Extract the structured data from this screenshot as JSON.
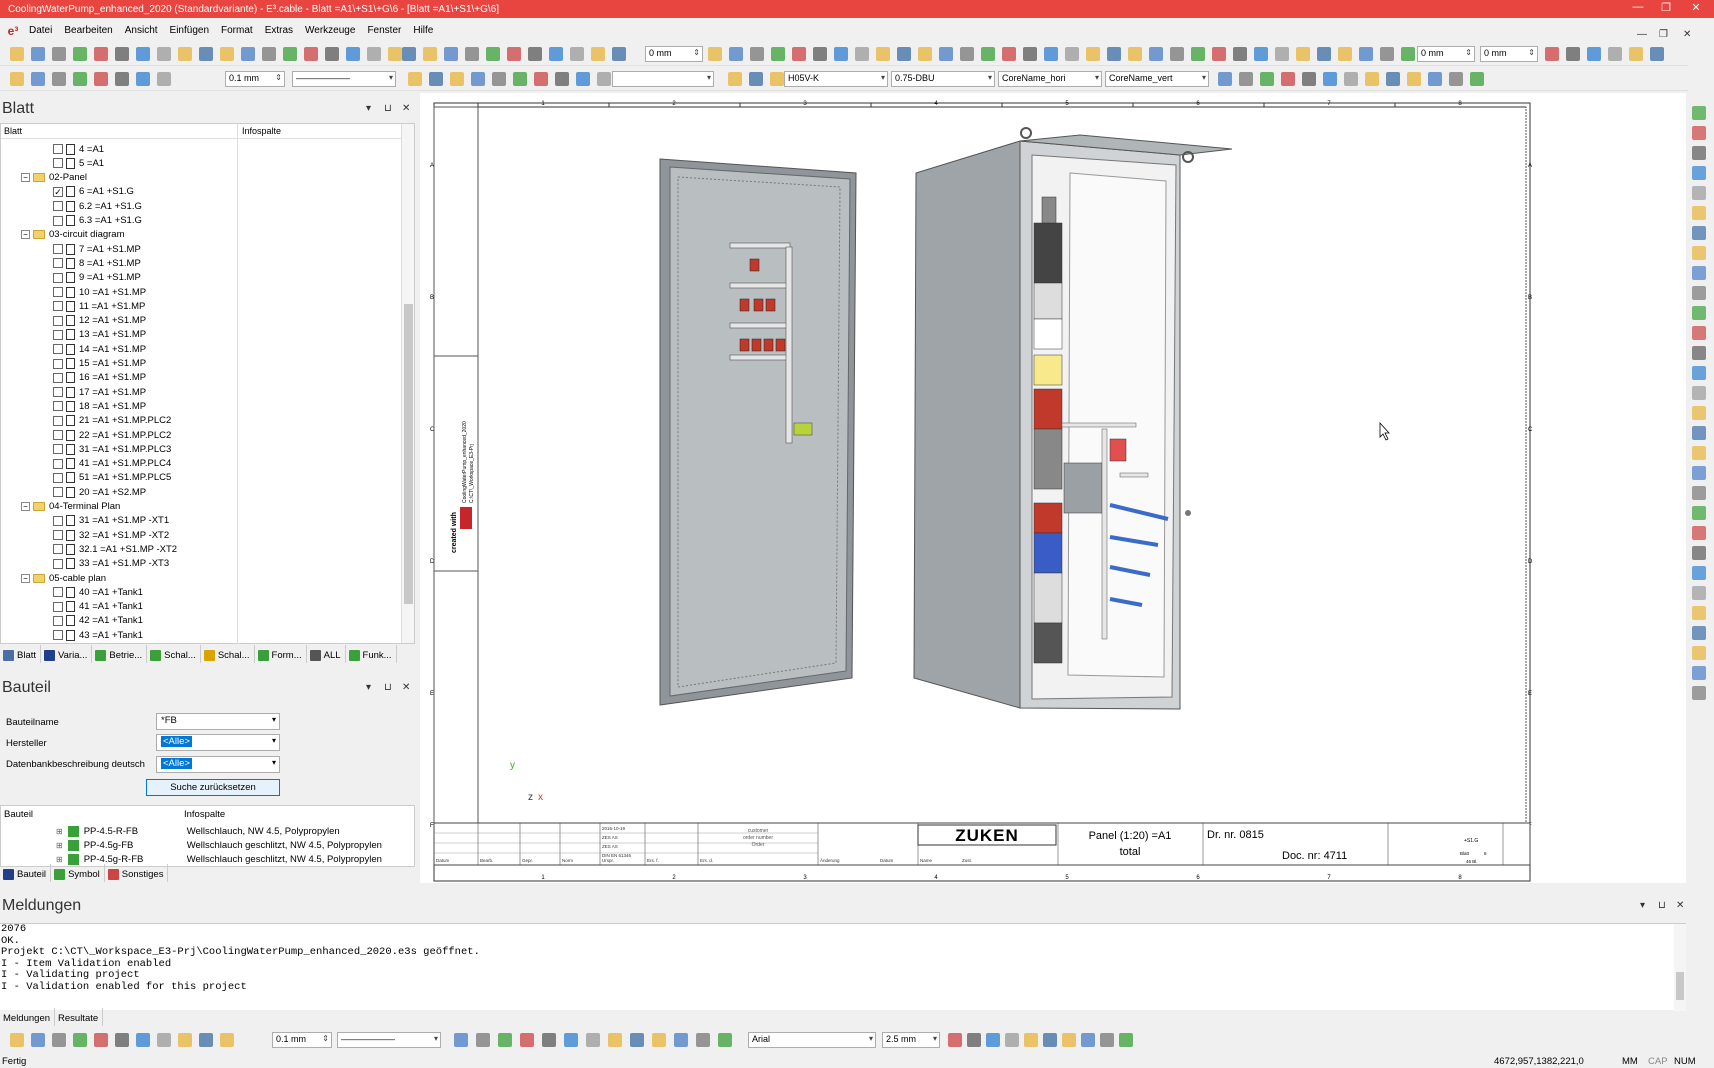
{
  "titlebar": {
    "text": "CoolingWaterPump_enhanced_2020 (Standardvariante) - E³.cable - Blatt =A1\\+S1\\+G\\6 - [Blatt =A1\\+S1\\+G\\6]",
    "min": "—",
    "restore": "❐",
    "close": "✕"
  },
  "app_logo": "e³",
  "menu": [
    "Datei",
    "Bearbeiten",
    "Ansicht",
    "Einfügen",
    "Format",
    "Extras",
    "Werkzeuge",
    "Fenster",
    "Hilfe"
  ],
  "mdi_controls": {
    "min": "—",
    "restore": "❐",
    "close": "✕"
  },
  "toolbar1": {
    "offset1": "0 mm",
    "offset2": "0 mm",
    "offset3": "0 mm"
  },
  "toolbar2": {
    "line_width": "0.1 mm",
    "cable_type": "H05V-K",
    "wire_type": "0.75-DBU",
    "core_name_h": "CoreName_hori",
    "core_name_v": "CoreName_vert"
  },
  "blatt_panel": {
    "title": "Blatt",
    "col1": "Blatt",
    "col2": "Infospalte",
    "pin": "⊔",
    "close": "✕",
    "menu": "▾"
  },
  "tree": [
    {
      "type": "page",
      "label": "4 =A1",
      "level": 2
    },
    {
      "type": "page",
      "label": "5 =A1",
      "level": 2
    },
    {
      "type": "folder",
      "label": "02-Panel",
      "level": 1
    },
    {
      "type": "page",
      "label": "6 =A1 +S1.G",
      "level": 2,
      "checked": true
    },
    {
      "type": "page",
      "label": "6.2 =A1 +S1.G",
      "level": 2
    },
    {
      "type": "page",
      "label": "6.3 =A1 +S1.G",
      "level": 2
    },
    {
      "type": "folder",
      "label": "03-circuit diagram",
      "level": 1
    },
    {
      "type": "page",
      "label": "7 =A1 +S1.MP",
      "level": 2
    },
    {
      "type": "page",
      "label": "8 =A1 +S1.MP",
      "level": 2
    },
    {
      "type": "page",
      "label": "9 =A1 +S1.MP",
      "level": 2
    },
    {
      "type": "page",
      "label": "10 =A1 +S1.MP",
      "level": 2
    },
    {
      "type": "page",
      "label": "11 =A1 +S1.MP",
      "level": 2
    },
    {
      "type": "page",
      "label": "12 =A1 +S1.MP",
      "level": 2
    },
    {
      "type": "page",
      "label": "13 =A1 +S1.MP",
      "level": 2
    },
    {
      "type": "page",
      "label": "14 =A1 +S1.MP",
      "level": 2
    },
    {
      "type": "page",
      "label": "15 =A1 +S1.MP",
      "level": 2
    },
    {
      "type": "page",
      "label": "16 =A1 +S1.MP",
      "level": 2
    },
    {
      "type": "page",
      "label": "17 =A1 +S1.MP",
      "level": 2
    },
    {
      "type": "page",
      "label": "18 =A1 +S1.MP",
      "level": 2
    },
    {
      "type": "page",
      "label": "21 =A1 +S1.MP.PLC2",
      "level": 2
    },
    {
      "type": "page",
      "label": "22 =A1 +S1.MP.PLC2",
      "level": 2
    },
    {
      "type": "page",
      "label": "31 =A1 +S1.MP.PLC3",
      "level": 2
    },
    {
      "type": "page",
      "label": "41 =A1 +S1.MP.PLC4",
      "level": 2
    },
    {
      "type": "page",
      "label": "51 =A1 +S1.MP.PLC5",
      "level": 2
    },
    {
      "type": "page",
      "label": "20 =A1 +S2.MP",
      "level": 2
    },
    {
      "type": "folder",
      "label": "04-Terminal Plan",
      "level": 1
    },
    {
      "type": "page",
      "label": "31 =A1 +S1.MP -XT1",
      "level": 2
    },
    {
      "type": "page",
      "label": "32 =A1 +S1.MP -XT2",
      "level": 2
    },
    {
      "type": "page",
      "label": "32.1 =A1 +S1.MP -XT2",
      "level": 2
    },
    {
      "type": "page",
      "label": "33 =A1 +S1.MP -XT3",
      "level": 2
    },
    {
      "type": "folder",
      "label": "05-cable plan",
      "level": 1
    },
    {
      "type": "page",
      "label": "40 =A1 +Tank1",
      "level": 2
    },
    {
      "type": "page",
      "label": "41 =A1 +Tank1",
      "level": 2
    },
    {
      "type": "page",
      "label": "42 =A1 +Tank1",
      "level": 2
    },
    {
      "type": "page",
      "label": "43 =A1 +Tank1",
      "level": 2
    }
  ],
  "blatt_tabs": [
    {
      "label": "Blatt",
      "color": "#4a6fa5"
    },
    {
      "label": "Varia...",
      "color": "#1f3f8a"
    },
    {
      "label": "Betrie...",
      "color": "#3aa03a"
    },
    {
      "label": "Schal...",
      "color": "#3aa03a"
    },
    {
      "label": "Schal...",
      "color": "#d9a400"
    },
    {
      "label": "Form...",
      "color": "#3aa03a"
    },
    {
      "label": "ALL",
      "color": "#555"
    },
    {
      "label": "Funk...",
      "color": "#3aa03a"
    }
  ],
  "bauteil_panel": {
    "title": "Bauteil",
    "name_label": "Bauteilname",
    "name_value": "*FB",
    "hersteller_label": "Hersteller",
    "hersteller_value": "<Alle>",
    "db_label": "Datenbankbeschreibung deutsch",
    "db_value": "<Alle>",
    "reset_button": "Suche zurücksetzen",
    "col1": "Bauteil",
    "col2": "Infospalte"
  },
  "parts": [
    {
      "name": "PP-4.5-R-FB",
      "info": "Wellschlauch, NW 4.5, Polypropylen"
    },
    {
      "name": "PP-4.5g-FB",
      "info": "Wellschlauch geschlitzt, NW 4.5, Polypropylen"
    },
    {
      "name": "PP-4.5g-R-FB",
      "info": "Wellschlauch geschlitzt, NW 4.5, Polypropylen"
    }
  ],
  "bauteil_tabs": [
    {
      "label": "Bauteil",
      "color": "#1f3f8a"
    },
    {
      "label": "Symbol",
      "color": "#3aa03a"
    },
    {
      "label": "Sonstiges",
      "color": "#c44"
    }
  ],
  "titleblock": {
    "logo": "ZUKEN",
    "drawing_title": "Panel (1:20) =A1",
    "drawing_subtitle": "total",
    "dr_nr": "Dr. nr. 0815",
    "doc_nr": "Doc. nr: 4711",
    "customer_lines": [
      "customer",
      "order number",
      "Order"
    ],
    "date_lines": [
      "2016-10-19",
      "ZES AS",
      "ZES AS",
      "DIN EN 61346"
    ],
    "small_labels": [
      "Datum",
      "Bearb.",
      "Gepr.",
      "Norm",
      "Urspr.",
      "Ers. f.",
      "Ers. d.",
      "Änderung",
      "Datum",
      "Name",
      "Zust."
    ],
    "code1": "+S1.G",
    "sheet_label": "Blatt",
    "sheet_of": "6",
    "sheet_total": "46 Bl."
  },
  "sheet_cols": [
    "1",
    "2",
    "3",
    "4",
    "5",
    "6",
    "7",
    "8"
  ],
  "sheet_rows": [
    "A",
    "B",
    "C",
    "D",
    "E",
    "F"
  ],
  "sheet_side": [
    "created with",
    "CoolingWaterPump_enhanced_2020",
    "C:\\CT\\_Workspace_E3-Prj"
  ],
  "axes": {
    "y": "y",
    "z": "z",
    "x": "x"
  },
  "meldungen_panel": {
    "title": "Meldungen"
  },
  "messages": [
    "2076",
    "OK.",
    "Projekt C:\\CT\\_Workspace_E3-Prj\\CoolingWaterPump_enhanced_2020.e3s geöffnet.",
    "I - Item Validation enabled",
    "I - Validating project",
    "I - Validation enabled for this project"
  ],
  "msg_tabs": [
    {
      "label": "Meldungen"
    },
    {
      "label": "Resultate"
    }
  ],
  "bottom_toolbar": {
    "line_width": "0.1 mm",
    "font": "Arial",
    "font_size": "2.5 mm"
  },
  "status": {
    "left": "Fertig",
    "coords": "4672,957,1382,221,0",
    "mm": "MM",
    "cap": "CAP",
    "num": "NUM"
  }
}
